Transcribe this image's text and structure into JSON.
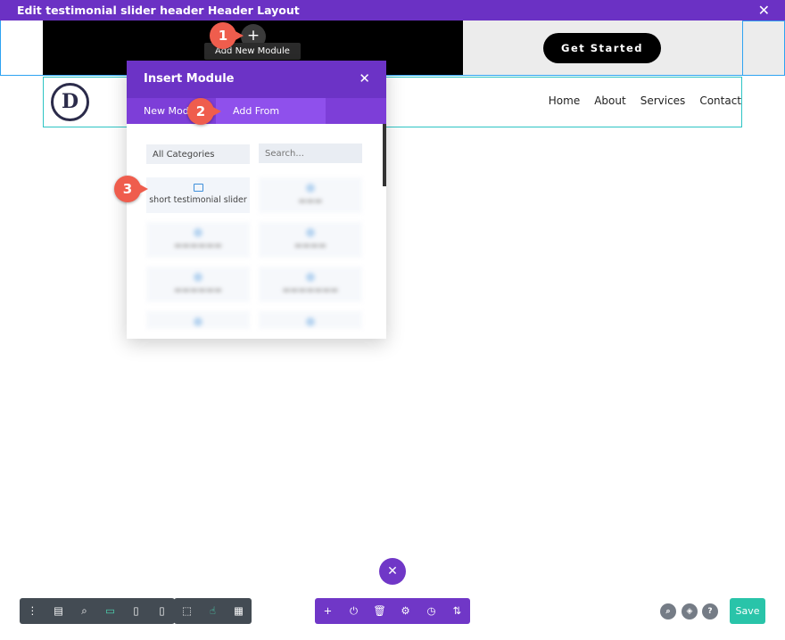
{
  "window": {
    "title": "Edit testimonial slider header Header Layout",
    "close_icon": "close-icon"
  },
  "header": {
    "cta_label": "Get Started",
    "add_button_icon": "plus-icon",
    "tooltip": "Add New Module",
    "logo_letter": "D",
    "menu": [
      "Home",
      "About",
      "Services",
      "Contact"
    ]
  },
  "modal": {
    "title": "Insert Module",
    "tabs": [
      "New Module",
      "Add From Library"
    ],
    "active_tab": "Add From Library",
    "category_select": "All Categories",
    "search_placeholder": "Search...",
    "items": [
      "short testimonial slider"
    ]
  },
  "badges": [
    "1",
    "2",
    "3"
  ],
  "toolbar": {
    "left_icons": [
      "more-vertical-icon",
      "wireframe-icon",
      "zoom-icon",
      "desktop-icon",
      "tablet-icon",
      "phone-icon"
    ],
    "mid_icons": [
      "select-icon",
      "click-mode-icon",
      "grid-icon"
    ],
    "center_icons": [
      "plus-icon",
      "power-icon",
      "trash-icon",
      "settings-icon",
      "history-icon",
      "sort-icon"
    ],
    "right_icons": [
      "search-icon",
      "layers-icon",
      "help-icon"
    ],
    "save_label": "Save"
  },
  "colors": {
    "purple": "#6b31c4",
    "accent": "#29c4a9",
    "badge": "#ef5d4d"
  }
}
